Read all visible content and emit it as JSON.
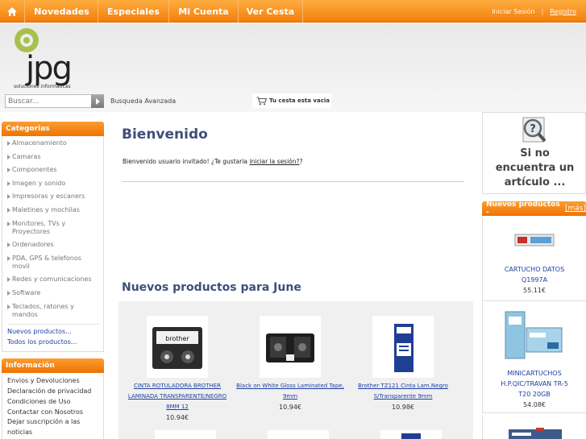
{
  "nav": {
    "items": [
      "Novedades",
      "Especiales",
      "Mi Cuenta",
      "Ver Cesta"
    ],
    "login": "Iniciar Sesión",
    "separator": "|",
    "register": "Registro"
  },
  "header": {
    "logo_text": "jpg",
    "logo_sub": "soluciones informáticas",
    "search_placeholder": "Buscar...",
    "advanced_search": "Busqueda Avanzada",
    "cart_text": "Tu cesta esta vacia"
  },
  "categories": {
    "title": "Categorias",
    "items": [
      "Almacenamiento",
      "Camaras",
      "Componentes",
      "Imagen y sonido",
      "Impresoras y escaners",
      "Maletines y mochilas",
      "Monitores, TVs y Proyectores",
      "Ordenadores",
      "PDA, GPS & telefonos movil",
      "Redes y comunicaciones",
      "Software",
      "Teclados, ratones y mandos"
    ],
    "links": [
      "Nuevos productos...",
      "Todos los productos..."
    ]
  },
  "info": {
    "title": "Información",
    "items": [
      "Envios y Devoluciones",
      "Declaración de privacidad",
      "Condiciones de Uso",
      "Contactar con Nosotros",
      "Dejar suscripción a las noticias"
    ]
  },
  "main": {
    "welcome_title": "Bienvenido",
    "welcome_prefix": "Bienvenido usuario invitado! ¿Te gustaria ",
    "welcome_link": "iniciar la sesión?",
    "welcome_suffix": "?",
    "new_products_title": "Nuevos productos para June",
    "products": [
      {
        "name": "CINTA ROTULADORA BROTHER LAMINADA TRANSPARENTE/NEGRO 8MM 12",
        "price": "10.94€"
      },
      {
        "name": "Black on White Gloss Laminated Tape, 9mm",
        "price": "10.94€"
      },
      {
        "name": "Brother TZ121 Cinta Lam.Negro S/Transparente 9mm",
        "price": "10.98€"
      }
    ]
  },
  "right": {
    "notfound_line1": "Si no",
    "notfound_line2": "encuentra un",
    "notfound_line3": "artículo ...",
    "new_title": "Nuevos productos - ",
    "new_more": "[más]",
    "products": [
      {
        "name": "CARTUCHO DATOS Q1997A",
        "price": "55.11€"
      },
      {
        "name": "MINICARTUCHOS H.P.QIC/TRAVAN TR-5 T20 20GB",
        "price": "54.08€"
      }
    ]
  }
}
